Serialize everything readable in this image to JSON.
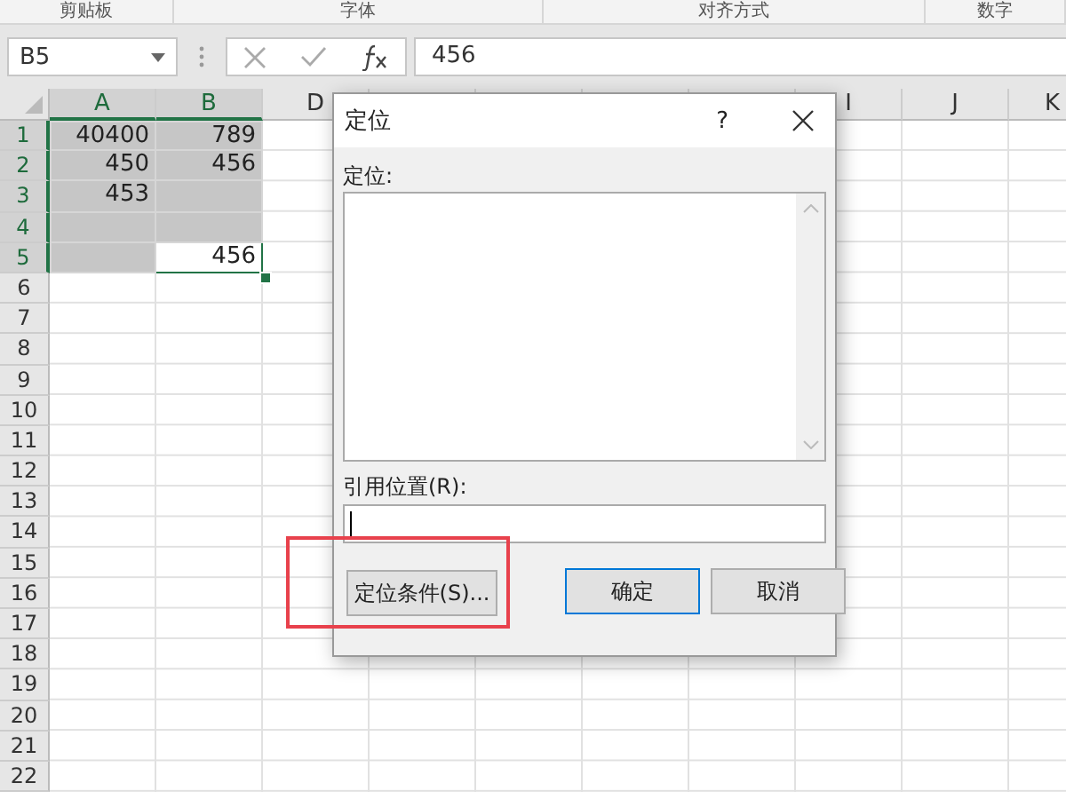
{
  "ribbon": {
    "groups": [
      "剪贴板",
      "字体",
      "对齐方式",
      "数字"
    ]
  },
  "formula_bar": {
    "name_box": "B5",
    "value": "456"
  },
  "sheet": {
    "columns": [
      {
        "label": "A",
        "selected": true
      },
      {
        "label": "B",
        "selected": true
      },
      {
        "label": "D",
        "selected": false
      },
      {
        "label": "I",
        "selected": false
      },
      {
        "label": "J",
        "selected": false
      },
      {
        "label": "K",
        "selected": false
      }
    ],
    "rows": [
      {
        "label": "1",
        "selected": true,
        "cells": [
          {
            "value": "40400",
            "selected": true
          },
          {
            "value": "789",
            "selected": true
          }
        ]
      },
      {
        "label": "2",
        "selected": true,
        "cells": [
          {
            "value": "450",
            "selected": true
          },
          {
            "value": "456",
            "selected": true
          }
        ]
      },
      {
        "label": "3",
        "selected": true,
        "cells": [
          {
            "value": "453",
            "selected": true
          },
          {
            "selected": true
          }
        ]
      },
      {
        "label": "4",
        "selected": true,
        "cells": [
          {
            "selected": true
          },
          {
            "selected": true
          }
        ]
      },
      {
        "label": "5",
        "selected": true,
        "cells": [
          {
            "selected": true
          },
          {
            "value": "456",
            "selected": false
          }
        ]
      },
      {
        "label": "6",
        "selected": false
      },
      {
        "label": "7",
        "selected": false
      },
      {
        "label": "8",
        "selected": false
      },
      {
        "label": "9",
        "selected": false
      },
      {
        "label": "10",
        "selected": false
      },
      {
        "label": "11",
        "selected": false
      },
      {
        "label": "12",
        "selected": false
      },
      {
        "label": "13",
        "selected": false
      },
      {
        "label": "14",
        "selected": false
      },
      {
        "label": "15",
        "selected": false
      },
      {
        "label": "16",
        "selected": false
      },
      {
        "label": "17",
        "selected": false
      },
      {
        "label": "18",
        "selected": false
      },
      {
        "label": "19",
        "selected": false
      },
      {
        "label": "20",
        "selected": false
      },
      {
        "label": "21",
        "selected": false
      },
      {
        "label": "22",
        "selected": false
      }
    ]
  },
  "dialog": {
    "title": "定位",
    "help": "?",
    "list_label": "定位:",
    "reference_label": "引用位置(R):",
    "buttons": [
      {
        "label": "定位条件(S)...",
        "default": false,
        "highlighted": true
      },
      {
        "label": "确定",
        "default": true,
        "highlighted": false
      },
      {
        "label": "取消",
        "default": false,
        "highlighted": false
      }
    ]
  }
}
